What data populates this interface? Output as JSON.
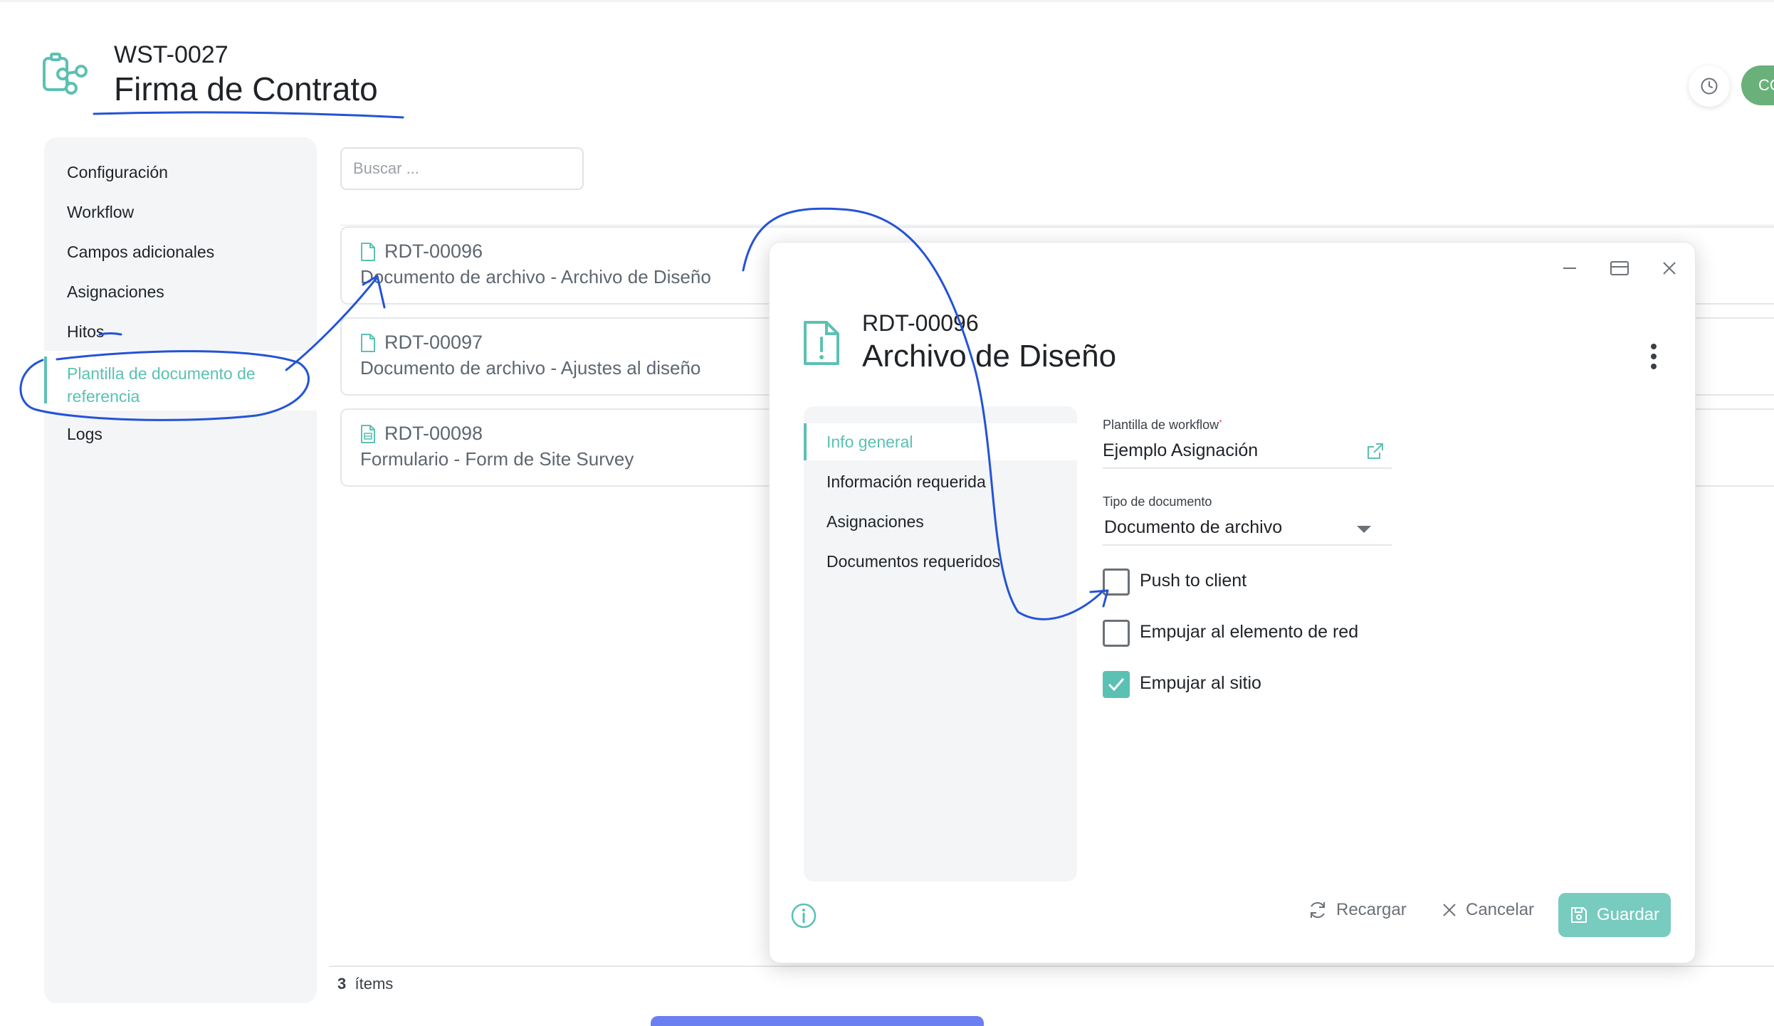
{
  "header": {
    "code": "WST-0027",
    "title": "Firma de Contrato",
    "right_button_label": "CO",
    "history_icon": "clock-icon",
    "logo_icon": "workflow-icon"
  },
  "sidebar": {
    "items": [
      {
        "label": "Configuración"
      },
      {
        "label": "Workflow"
      },
      {
        "label": "Campos adicionales"
      },
      {
        "label": "Asignaciones"
      },
      {
        "label": "Hitos"
      },
      {
        "label": "Plantilla de documento de referencia",
        "line1": "Plantilla de documento de",
        "line2": "referencia",
        "active": true
      },
      {
        "label": "Logs"
      }
    ]
  },
  "list": {
    "search_placeholder": "Buscar ...",
    "items": [
      {
        "id": "RDT-00096",
        "desc": "Documento de archivo - Archivo de Diseño",
        "icon": "file-icon"
      },
      {
        "id": "RDT-00097",
        "desc": "Documento de archivo - Ajustes al diseño",
        "icon": "file-icon"
      },
      {
        "id": "RDT-00098",
        "desc": "Formulario - Form de Site Survey",
        "icon": "form-icon"
      }
    ],
    "count": "3",
    "count_label": "ítems"
  },
  "modal": {
    "code": "RDT-00096",
    "title": "Archivo de Diseño",
    "tabs": [
      {
        "label": "Info general",
        "active": true
      },
      {
        "label": "Información requerida"
      },
      {
        "label": "Asignaciones"
      },
      {
        "label": "Documentos requeridos"
      }
    ],
    "fields": {
      "workflow_label": "Plantilla de workflow",
      "workflow_required": "*",
      "workflow_value": "Ejemplo Asignación",
      "doctype_label": "Tipo de documento",
      "doctype_value": "Documento de archivo"
    },
    "checkboxes": [
      {
        "label": "Push to client",
        "checked": false
      },
      {
        "label": "Empujar al elemento de red",
        "checked": false
      },
      {
        "label": "Empujar al sitio",
        "checked": true
      }
    ],
    "footer": {
      "reload": "Recargar",
      "cancel": "Cancelar",
      "save": "Guardar"
    }
  },
  "colors": {
    "accent": "#5bc1b3",
    "save_bg": "#78cbbf",
    "green": "#6ab07a",
    "annotation": "#2453d6",
    "bottom_bar": "#6a7ff0"
  }
}
